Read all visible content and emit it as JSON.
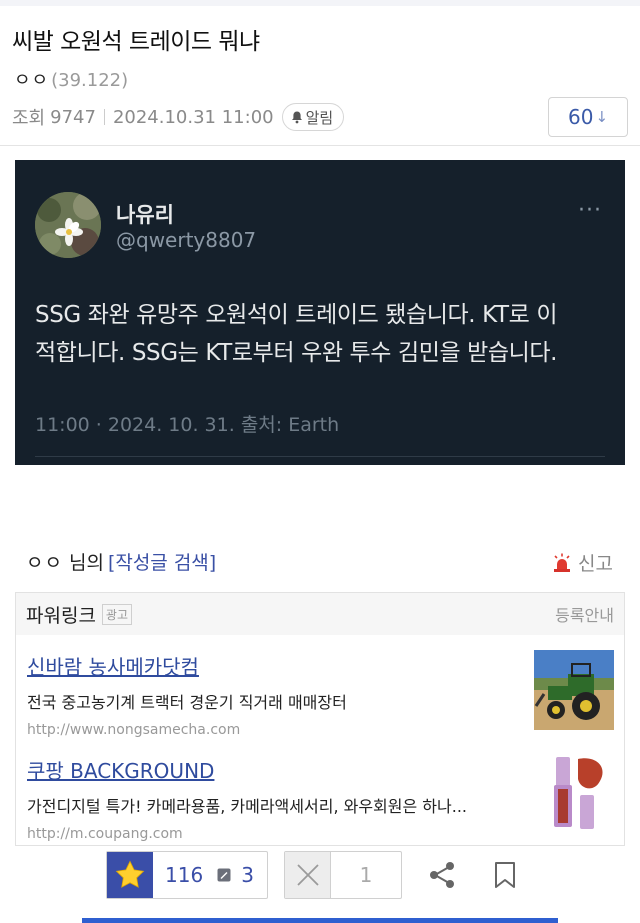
{
  "post": {
    "title": "씨발 오원석 트레이드 뭐냐",
    "author_name": "ㅇㅇ",
    "author_count": "(39.122)",
    "views_label": "조회",
    "views": "9747",
    "datetime": "2024.10.31 11:00",
    "alarm_label": "알림",
    "comment_count": "60",
    "comment_arrow": "↓"
  },
  "tweet": {
    "name": "나유리",
    "handle": "@qwerty8807",
    "more": "···",
    "line1": "SSG 좌완 유망주 오원석이 트레이드 됐습니다. KT로 이",
    "line2": "적합니다. SSG는 KT로부터 우완 투수 김민을 받습니다.",
    "meta": "11:00 · 2024. 10. 31. 출처: Earth",
    "colors": {
      "bg": "#15202b",
      "text": "#e7e9ea",
      "muted": "#8b98a5"
    }
  },
  "writer": {
    "name": "ㅇㅇ",
    "suffix": "님의",
    "search_link": "[작성글 검색]",
    "report": "신고"
  },
  "ads": {
    "header": "파워링크",
    "badge": "광고",
    "register": "등록안내",
    "items": [
      {
        "title": "신바람 농사메카닷컴",
        "desc": "전국 중고농기계 트랙터 경운기 직거래 매매장터",
        "url": "http://www.nongsamecha.com"
      },
      {
        "title": "쿠팡 BACKGROUND",
        "desc": "가전디지털 특가! 카메라용품, 카메라액세서리, 와우회원은 하나...",
        "url": "http://m.coupang.com"
      }
    ]
  },
  "actions": {
    "upvotes": "116",
    "memo_count": "3",
    "downvotes": "1"
  },
  "colors": {
    "accent": "#3a4ea8",
    "link": "#2f4b9e",
    "bottom_indicator": "#2f5fd0"
  }
}
